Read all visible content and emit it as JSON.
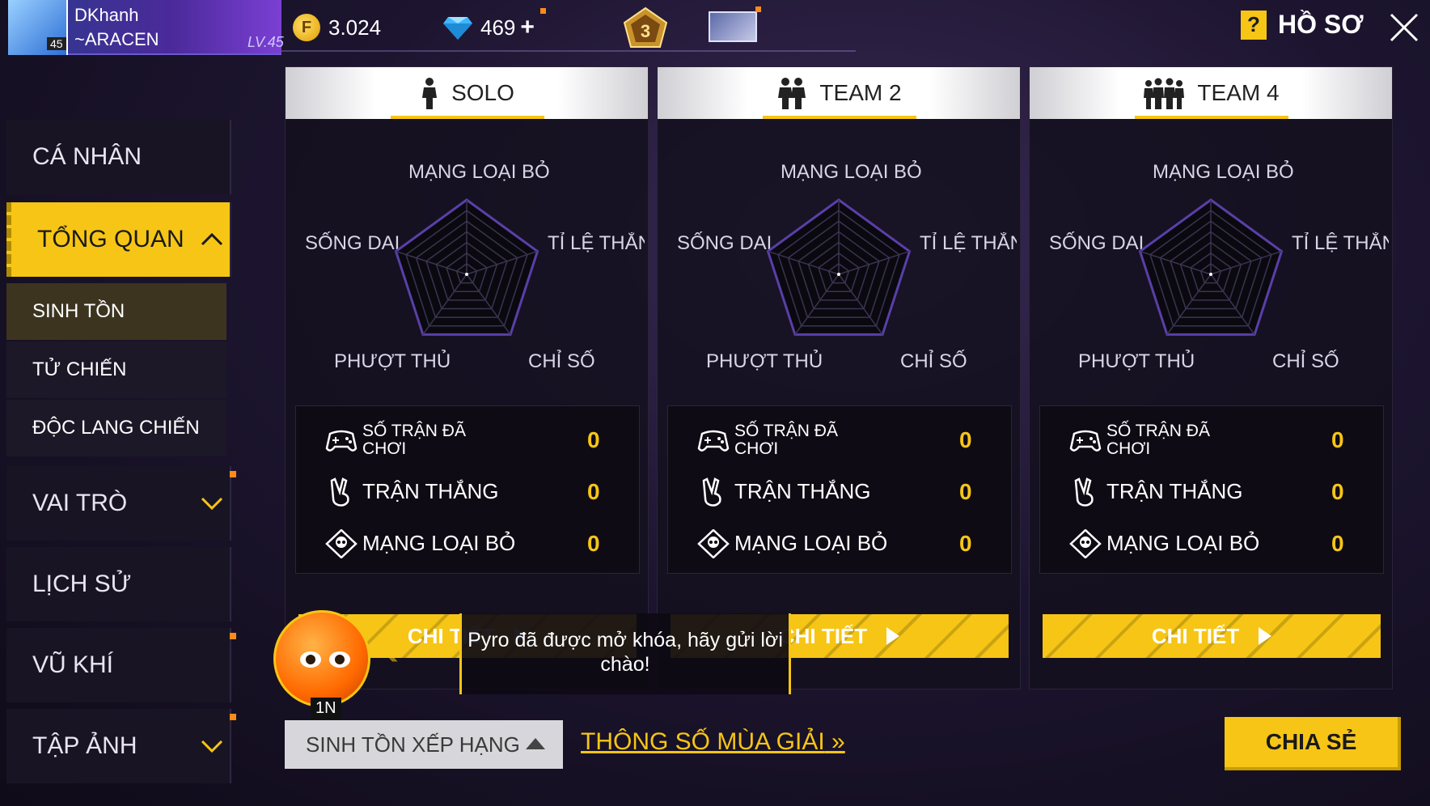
{
  "top_bar": {
    "player_name": "DKhanh",
    "clan_name": "~ARACEN",
    "level": "LV.45",
    "avatar_level": "45",
    "gold": "3.024",
    "diamonds": "469",
    "diamond_add": "+",
    "rank_number": "3",
    "profile_label": "HỒ SƠ",
    "help_symbol": "?"
  },
  "sidebar": {
    "items": [
      {
        "label": "CÁ NHÂN"
      },
      {
        "label": "TỔNG QUAN"
      },
      {
        "label": "VAI TRÒ"
      },
      {
        "label": "LỊCH SỬ"
      },
      {
        "label": "VŨ KHÍ"
      },
      {
        "label": "TẬP ẢNH"
      }
    ],
    "sub_items": [
      {
        "label": "SINH TỒN"
      },
      {
        "label": "TỬ CHIẾN"
      },
      {
        "label": "ĐỘC LANG CHIẾN"
      }
    ]
  },
  "panels": [
    {
      "title": "SOLO",
      "radar_labels": {
        "top": "MẠNG LOẠI BỎ",
        "left": "SỐNG DAI",
        "right": "TỈ LỆ THẮNG",
        "bottom_left": "PHƯỢT THỦ",
        "bottom_right": "CHỈ SỐ"
      },
      "stats": [
        {
          "label": "SỐ TRẬN ĐÃ CHƠI",
          "value": "0"
        },
        {
          "label": "TRẬN THẮNG",
          "value": "0"
        },
        {
          "label": "MẠNG LOẠI BỎ",
          "value": "0"
        }
      ],
      "detail_label": "CHI TIẾT"
    },
    {
      "title": "TEAM 2",
      "radar_labels": {
        "top": "MẠNG LOẠI BỎ",
        "left": "SỐNG DAI",
        "right": "TỈ LỆ THẮNG",
        "bottom_left": "PHƯỢT THỦ",
        "bottom_right": "CHỈ SỐ"
      },
      "stats": [
        {
          "label": "SỐ TRẬN ĐÃ CHƠI",
          "value": "0"
        },
        {
          "label": "TRẬN THẮNG",
          "value": "0"
        },
        {
          "label": "MẠNG LOẠI BỎ",
          "value": "0"
        }
      ],
      "detail_label": "CHI TIẾT"
    },
    {
      "title": "TEAM 4",
      "radar_labels": {
        "top": "MẠNG LOẠI BỎ",
        "left": "SỐNG DAI",
        "right": "TỈ LỆ THẮNG",
        "bottom_left": "PHƯỢT THỦ",
        "bottom_right": "CHỈ SỐ"
      },
      "stats": [
        {
          "label": "SỐ TRẬN ĐÃ CHƠI",
          "value": "0"
        },
        {
          "label": "TRẬN THẮNG",
          "value": "0"
        },
        {
          "label": "MẠNG LOẠI BỎ",
          "value": "0"
        }
      ],
      "detail_label": "CHI TIẾT"
    }
  ],
  "bottom": {
    "mode_select": "SINH TỒN XẾP HẠNG",
    "season_link": "THÔNG SỐ MÙA GIẢI",
    "share_button": "CHIA SẺ"
  },
  "notification": {
    "message": "Pyro đã được mở khóa, hãy gửi lời chào!",
    "pet_time": "1N"
  },
  "colors": {
    "accent": "#f7c515",
    "background": "#1d1530",
    "panel": "#14101e"
  }
}
